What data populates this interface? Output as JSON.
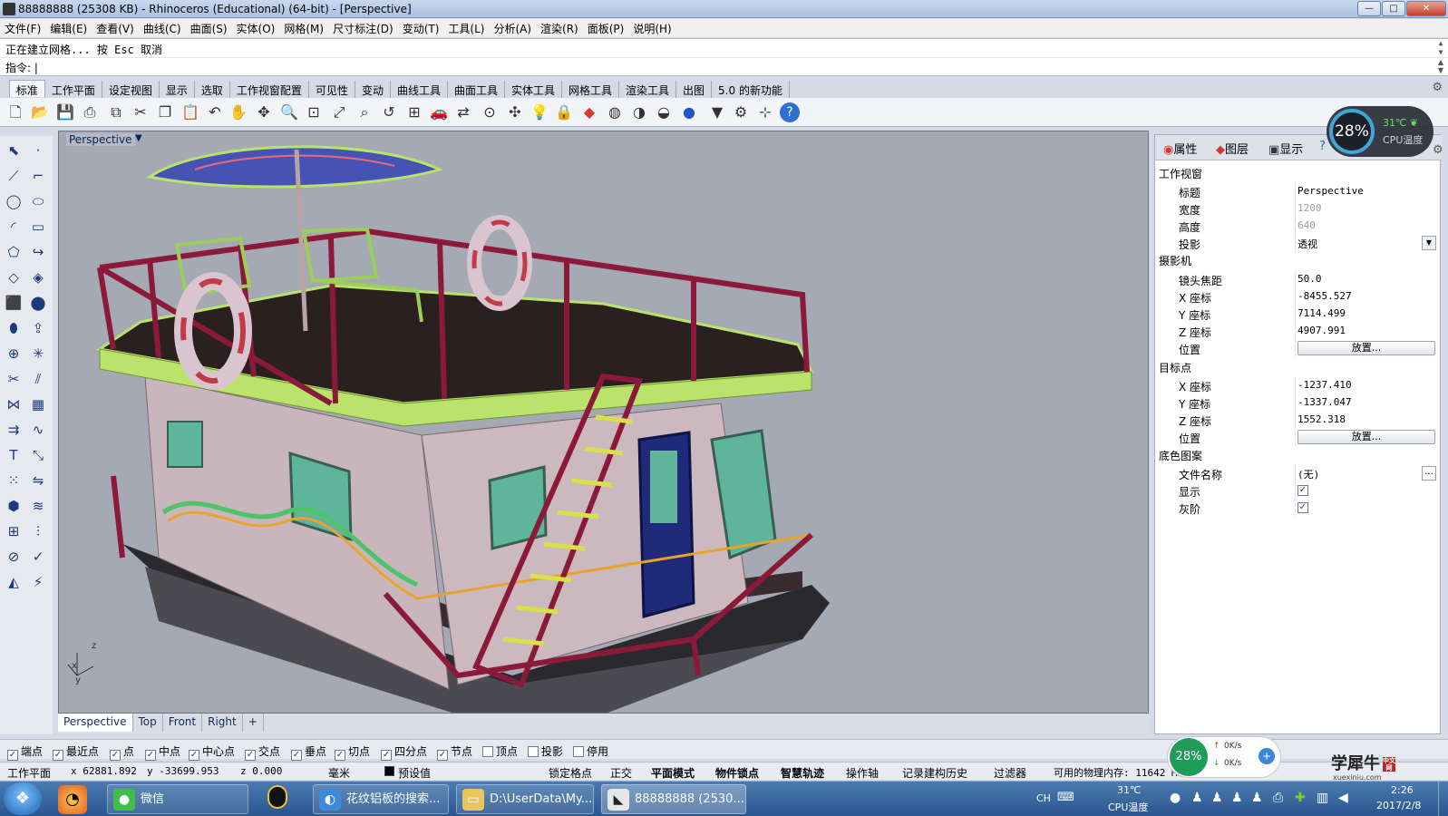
{
  "window": {
    "title": "88888888 (25308 KB) - Rhinoceros (Educational) (64-bit) - [Perspective]",
    "minimize": "—",
    "maximize": "□",
    "close": "✕"
  },
  "menu": [
    "文件(F)",
    "编辑(E)",
    "查看(V)",
    "曲线(C)",
    "曲面(S)",
    "实体(O)",
    "网格(M)",
    "尺寸标注(D)",
    "变动(T)",
    "工具(L)",
    "分析(A)",
    "渲染(R)",
    "面板(P)",
    "说明(H)"
  ],
  "command": {
    "history": "正在建立网格... 按 Esc 取消",
    "prompt": "指令: |"
  },
  "toolbar_tabs": [
    "标准",
    "工作平面",
    "设定视图",
    "显示",
    "选取",
    "工作视窗配置",
    "可见性",
    "变动",
    "曲线工具",
    "曲面工具",
    "实体工具",
    "网格工具",
    "渲染工具",
    "出图",
    "5.0 的新功能"
  ],
  "toolbar_icons": [
    "new-file-icon",
    "open-folder-icon",
    "save-icon",
    "print-icon",
    "import-icon",
    "cut-icon",
    "copy-icon",
    "paste-icon",
    "undo-icon",
    "pan-hand-icon",
    "rotate-view-icon",
    "zoom-icon",
    "zoom-window-icon",
    "zoom-extents-icon",
    "zoom-selected-icon",
    "undo-view-icon",
    "four-viewports-icon",
    "car-icon",
    "toggle-icon",
    "circle-point-icon",
    "move-icon",
    "light-bulb-icon",
    "lock-icon",
    "layer-icon",
    "color-wheel-icon",
    "sphere-gray-icon",
    "sphere-shaded-icon",
    "sphere-blue-icon",
    "filter-icon",
    "gear-icon",
    "snap-icon",
    "help-icon"
  ],
  "viewport": {
    "label": "Perspective",
    "axis_x": "x",
    "axis_y": "y",
    "axis_z": "z"
  },
  "viewport_tabs": [
    "Perspective",
    "Top",
    "Front",
    "Right",
    "+"
  ],
  "panel": {
    "tabs": [
      "属性",
      "图层",
      "显示",
      "?"
    ],
    "sections": {
      "viewport": "工作视窗",
      "camera": "摄影机",
      "target": "目标点",
      "wallpaper": "底色图案"
    },
    "viewport_rows": [
      {
        "label": "标题",
        "value": "Perspective",
        "dim": false
      },
      {
        "label": "宽度",
        "value": "1200",
        "dim": true
      },
      {
        "label": "高度",
        "value": "640",
        "dim": true
      },
      {
        "label": "投影",
        "value": "透视",
        "dim": false
      }
    ],
    "camera_rows": [
      {
        "label": "镜头焦距",
        "value": "50.0"
      },
      {
        "label": "X 座标",
        "value": "-8455.527"
      },
      {
        "label": "Y 座标",
        "value": "7114.499"
      },
      {
        "label": "Z 座标",
        "value": "4907.991"
      }
    ],
    "camera_place_label": "位置",
    "place_button": "放置...",
    "target_rows": [
      {
        "label": "X 座标",
        "value": "-1237.410"
      },
      {
        "label": "Y 座标",
        "value": "-1337.047"
      },
      {
        "label": "Z 座标",
        "value": "1552.318"
      }
    ],
    "target_place_label": "位置",
    "wallpaper_file_label": "文件名称",
    "wallpaper_file_value": "(无)",
    "wallpaper_file_btn": "...",
    "wallpaper_show_label": "显示",
    "wallpaper_gray_label": "灰阶",
    "check_mark": "✓"
  },
  "cpu": {
    "percent": "28%",
    "temp": "31℃",
    "label": "CPU温度"
  },
  "osnaps": [
    {
      "label": "端点",
      "checked": true
    },
    {
      "label": "最近点",
      "checked": true
    },
    {
      "label": "点",
      "checked": true
    },
    {
      "label": "中点",
      "checked": true
    },
    {
      "label": "中心点",
      "checked": true
    },
    {
      "label": "交点",
      "checked": true
    },
    {
      "label": "垂点",
      "checked": true
    },
    {
      "label": "切点",
      "checked": true
    },
    {
      "label": "四分点",
      "checked": true
    },
    {
      "label": "节点",
      "checked": true
    },
    {
      "label": "顶点",
      "checked": false
    },
    {
      "label": "投影",
      "checked": false
    },
    {
      "label": "停用",
      "checked": false
    }
  ],
  "status": {
    "cplane": "工作平面",
    "x": "x 62881.892",
    "y": "y -33699.953",
    "z": "z 0.000",
    "unit": "毫米",
    "layer_swatch": "#000000",
    "layer": "预设值",
    "items": [
      "锁定格点",
      "正交",
      "平面模式",
      "物件锁点",
      "智慧轨迹",
      "操作轴",
      "记录建构历史",
      "过滤器"
    ],
    "bold_items": [
      "平面模式",
      "物件锁点",
      "智慧轨迹"
    ],
    "memory": "可用的物理内存: 11642 MB"
  },
  "net": {
    "percent": "28%",
    "up": "0K/s",
    "down": "0K/s"
  },
  "watermark": {
    "main": "学犀牛",
    "sub": "xuexiniu.com",
    "tag": "中文网"
  },
  "taskbar": {
    "tasks": [
      "微信",
      "花纹铝板的搜索...",
      "D:\\UserData\\My...",
      "88888888 (2530..."
    ],
    "lang": "CH",
    "temp": "31℃",
    "temp_label": "CPU温度",
    "time": "2:26",
    "date": "2017/2/8"
  },
  "colors": {
    "viewport_bg": "#a4a9b4",
    "deck_rail": "#8b1a3a",
    "deck_trim": "#b9e36a",
    "cabin_wall": "#c9b5bc",
    "window_glass": "#5fb59c",
    "door": "#1f2a7a"
  }
}
